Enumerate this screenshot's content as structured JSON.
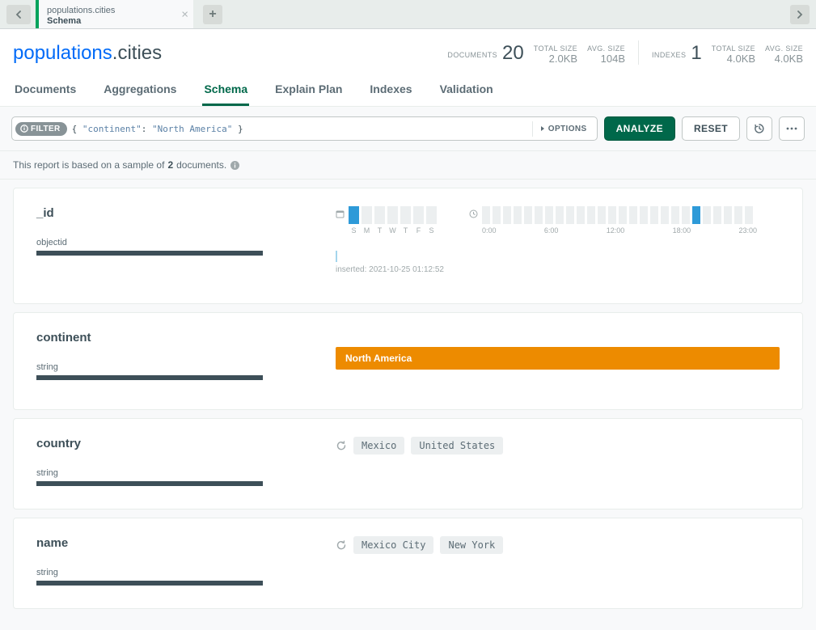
{
  "tab": {
    "title": "populations.cities",
    "subtitle": "Schema"
  },
  "namespace": {
    "db": "populations",
    "coll": "cities"
  },
  "stats": {
    "documents_label": "DOCUMENTS",
    "documents_value": "20",
    "col_totalsize_label": "TOTAL SIZE",
    "col_totalsize_value": "2.0KB",
    "col_avgsize_label": "AVG. SIZE",
    "col_avgsize_value": "104B",
    "indexes_label": "INDEXES",
    "indexes_value": "1",
    "idx_totalsize_label": "TOTAL SIZE",
    "idx_totalsize_value": "4.0KB",
    "idx_avgsize_label": "AVG. SIZE",
    "idx_avgsize_value": "4.0KB"
  },
  "ctabs": {
    "documents": "Documents",
    "aggregations": "Aggregations",
    "schema": "Schema",
    "explain": "Explain Plan",
    "indexes": "Indexes",
    "validation": "Validation"
  },
  "query": {
    "filter_label": "FILTER",
    "brace_open": "{",
    "key": "\"continent\"",
    "colon": ": ",
    "value": "\"North America\"",
    "brace_close": " }",
    "options_label": "OPTIONS",
    "analyze_label": "ANALYZE",
    "reset_label": "RESET"
  },
  "notice": {
    "prefix": "This report is based on a sample of ",
    "count": "2",
    "suffix": " documents."
  },
  "fields": {
    "id": {
      "name": "_id",
      "type": "objectid",
      "days": [
        "S",
        "M",
        "T",
        "W",
        "T",
        "F",
        "S"
      ],
      "hours": [
        "0:00",
        "6:00",
        "12:00",
        "18:00",
        "23:00"
      ],
      "inserted": "inserted: 2021-10-25 01:12:52"
    },
    "continent": {
      "name": "continent",
      "type": "string",
      "value": "North America"
    },
    "country": {
      "name": "country",
      "type": "string",
      "values": [
        "Mexico",
        "United States"
      ]
    },
    "cityname": {
      "name": "name",
      "type": "string",
      "values": [
        "Mexico City",
        "New York"
      ]
    }
  }
}
